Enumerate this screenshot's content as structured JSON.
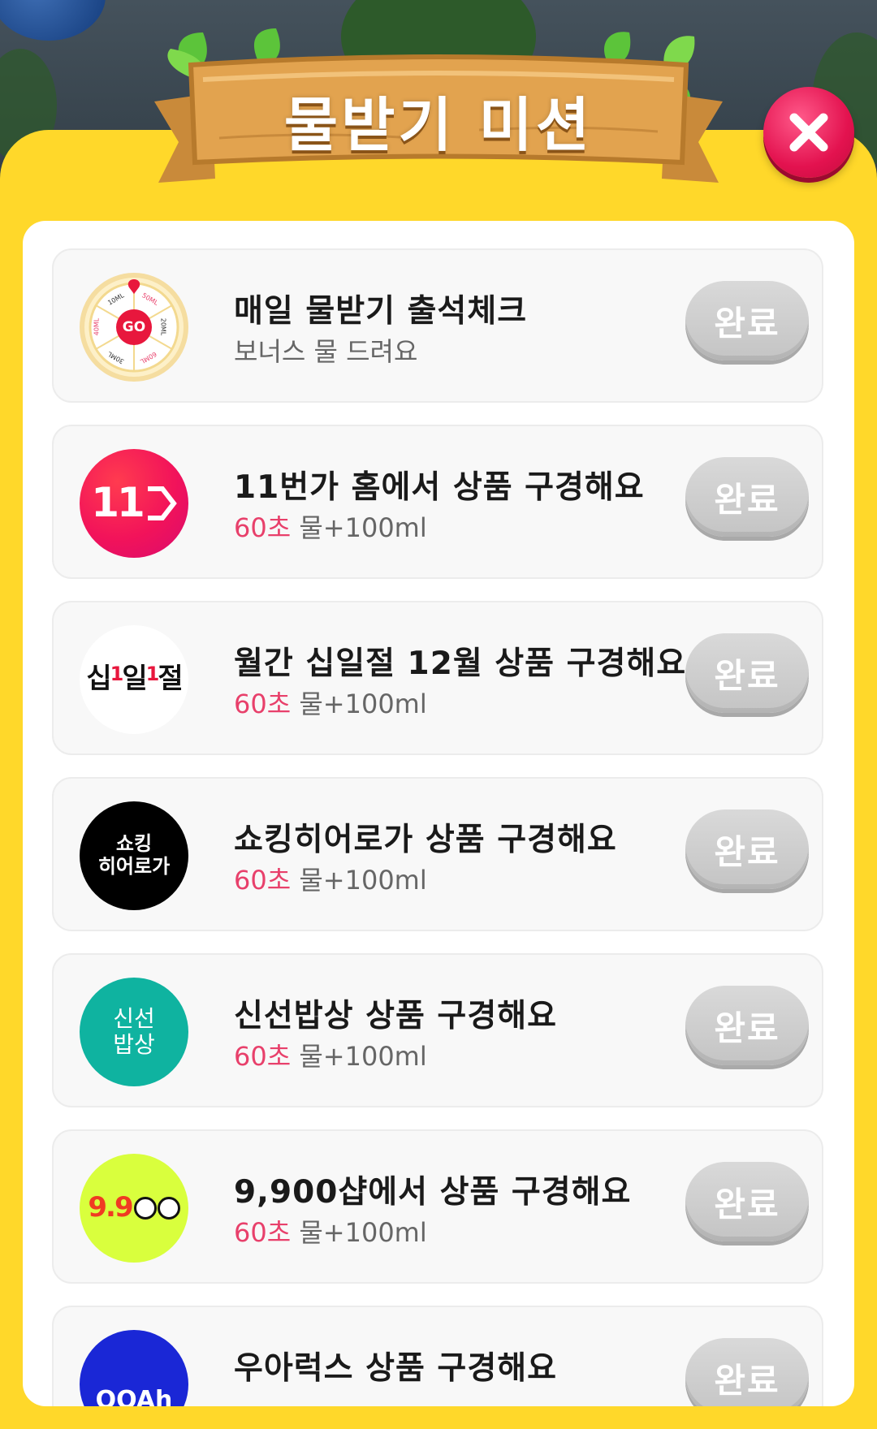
{
  "header": {
    "title": "물받기 미션"
  },
  "missions": [
    {
      "title": "매일 물받기 출석체크",
      "subtitle": "보너스 물 드려요",
      "status": "완료",
      "logo_icon": "roulette-icon",
      "wheel": {
        "center": "GO",
        "labels": [
          "10ML",
          "50ML",
          "20ML",
          "60ML",
          "30ML",
          "40ML"
        ]
      }
    },
    {
      "title": "11번가 홈에서 상품 구경해요",
      "seconds": "60초",
      "reward": "물+100ml",
      "status": "완료",
      "logo_icon": "11st-logo-icon",
      "logo_text": "11",
      "color": "#f2135a"
    },
    {
      "title": "월간 십일절 12월 상품 구경해요",
      "seconds": "60초",
      "reward": "물+100ml",
      "status": "완료",
      "logo_icon": "sipiljeol-logo-icon",
      "logo_text_a": "십",
      "logo_text_b": "1",
      "logo_text_c": "일",
      "logo_text_d": "1",
      "logo_text_e": "절"
    },
    {
      "title": "쇼킹히어로가 상품 구경해요",
      "seconds": "60초",
      "reward": "물+100ml",
      "status": "완료",
      "logo_icon": "shocking-hero-logo-icon",
      "logo_line1": "쇼킹",
      "logo_line2": "히어로가"
    },
    {
      "title": "신선밥상 상품 구경해요",
      "seconds": "60초",
      "reward": "물+100ml",
      "status": "완료",
      "logo_icon": "fresh-table-logo-icon",
      "logo_line1": "신선",
      "logo_line2": "밥상",
      "color": "#0fb3a0"
    },
    {
      "title": "9,900샵에서 상품 구경해요",
      "seconds": "60초",
      "reward": "물+100ml",
      "status": "완료",
      "logo_icon": "9900-shop-logo-icon",
      "logo_text": "9.9",
      "color": "#d9ff3d"
    },
    {
      "title": "우아럭스 상품 구경해요",
      "status": "완료",
      "logo_icon": "woalux-logo-icon",
      "logo_text": "OOAh",
      "color": "#1a27d6"
    }
  ]
}
